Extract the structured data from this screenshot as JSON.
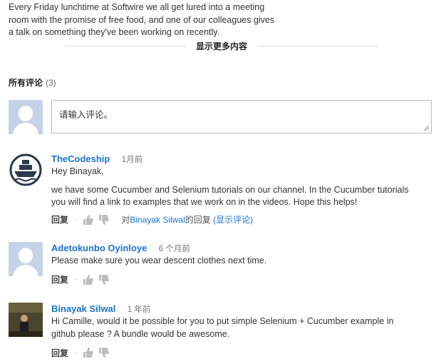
{
  "description": {
    "lines": [
      "Every Friday lunchtime at Softwire we all get lured into a meeting",
      "room with the promise of free food, and one of our colleagues gives",
      "a talk on something they've been working on recently."
    ]
  },
  "show_more": {
    "label": "显示更多内容"
  },
  "comments_section": {
    "title": "所有评论",
    "count": "(3)",
    "input_placeholder": "请输入评论。"
  },
  "comments": [
    {
      "author": "TheCodeship",
      "time": "1月前",
      "lines": [
        "Hey Binayak,",
        "we have some Cucumber and Selenium tutorials on our channel. In the Cucumber tutorials",
        "you will find a link to examples that we work on in the videos. Hope this helps!"
      ],
      "reply": "回复",
      "reply_to_prefix": "对",
      "reply_to_name": "Binayak Silwal",
      "reply_to_suffix": "的回复",
      "show_comments": "(显示评论)",
      "avatar": "ship-logo"
    },
    {
      "author": "Adetokunbo Oyinloye",
      "time": "6 个月前",
      "lines": [
        "Please make sure you wear descent clothes next time."
      ],
      "reply": "回复",
      "avatar": "default-user"
    },
    {
      "author": "Binayak Silwal",
      "time": "1 年前",
      "lines": [
        "Hi Camille, would it be possible for you to put simple Selenium + Cucumber example in",
        "github please ? A bundle would be awesome."
      ],
      "reply": "回复",
      "avatar": "user-photo"
    }
  ],
  "icons": {
    "thumb_up": "thumbs-up-icon",
    "thumb_down": "thumbs-down-icon",
    "separator": "·"
  },
  "colors": {
    "link": "#1b74c7",
    "avatar_default": "#c5d3e8"
  }
}
